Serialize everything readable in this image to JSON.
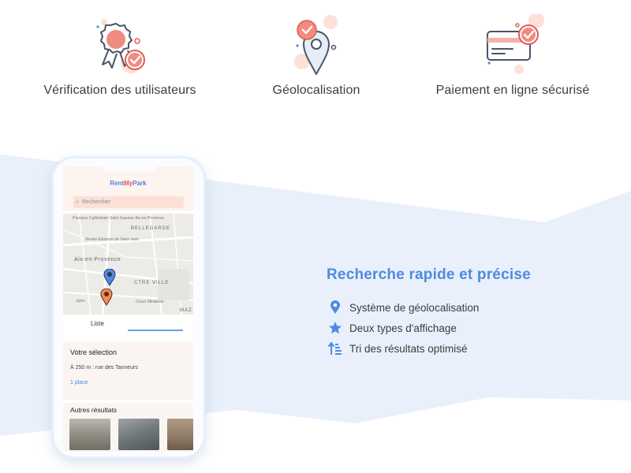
{
  "features": [
    {
      "label": "Vérification des utilisateurs",
      "icon": "certified-badge-icon"
    },
    {
      "label": "Géolocalisation",
      "icon": "location-pin-icon"
    },
    {
      "label": "Paiement en ligne sécurisé",
      "icon": "credit-card-icon"
    }
  ],
  "phone": {
    "brand_prefix": "Rent",
    "brand_mid": "My",
    "brand_suffix": "Park",
    "search_placeholder": "Rechercher",
    "map_labels": {
      "church": "Paroisse Cathédrale Saint Sauveur Aix-en-Provence",
      "museum": "Musée Estienne de Saint-Jean",
      "bellegarde": "BELLEGARDE",
      "city": "Aix-en-Provence",
      "centre": "CTRE VILLE",
      "jules": "Jules",
      "mirabeau": "Cours Mirabeau",
      "maz": "MAZ"
    },
    "tab_list": "Liste",
    "selection_title": "Votre sélection",
    "selection_address": "À 250 m : rue des Tanneurs",
    "selection_places": "1 place",
    "other_title": "Autres résultats"
  },
  "section": {
    "title": "Recherche rapide et précise",
    "items": [
      {
        "text": "Système de géolocalisation",
        "icon": "map-pin-icon"
      },
      {
        "text": "Deux types d'affichage",
        "icon": "star-icon"
      },
      {
        "text": "Tri des résultats optimisé",
        "icon": "sort-ascending-icon"
      }
    ]
  },
  "colors": {
    "accent_blue": "#4d8be0",
    "coral": "#ef8c80",
    "band_blue": "#e9f0fb",
    "peach": "#fbe0d7"
  }
}
